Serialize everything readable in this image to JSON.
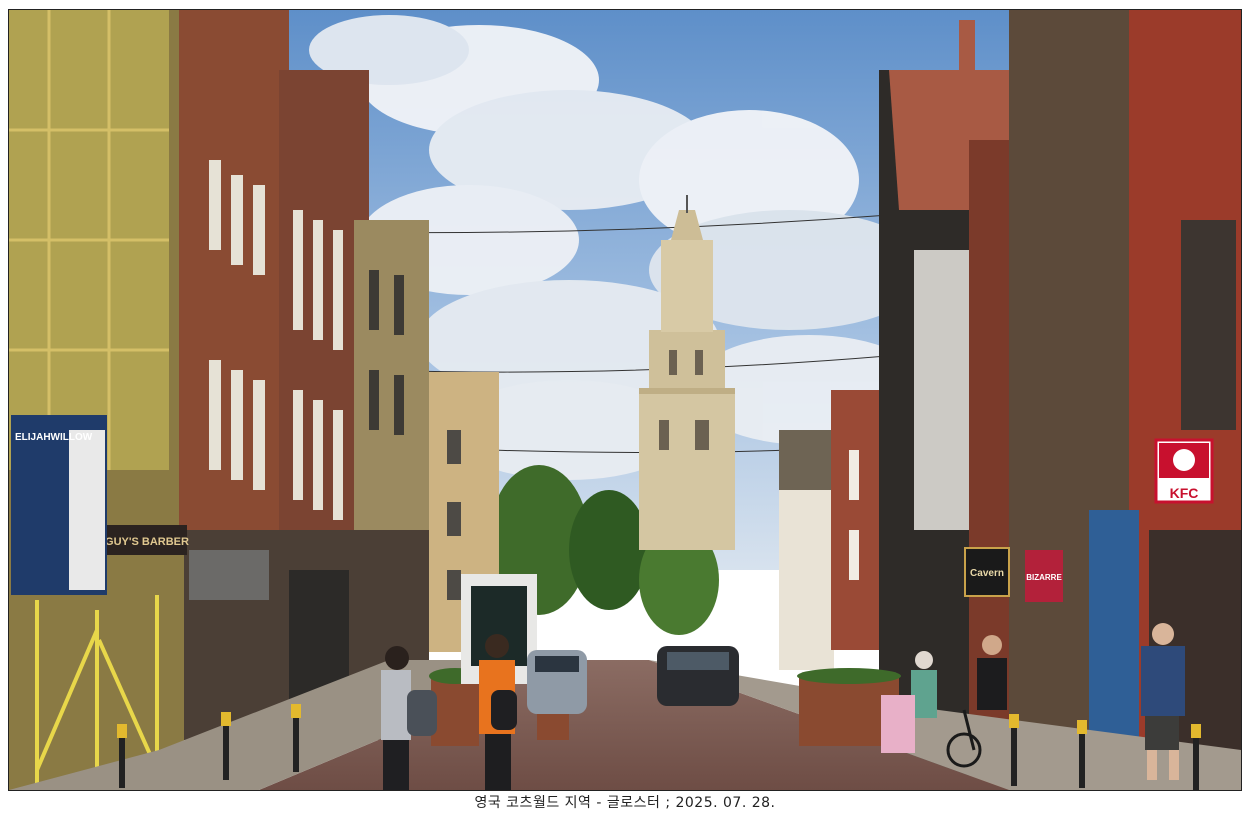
{
  "caption": "영국 코츠월드 지역 - 글로스터 ; 2025. 07. 28.",
  "signs": {
    "kfc": "KFC",
    "guys": "GUY'S BARBER",
    "elijah": "ELIJAHWILLOW",
    "bizarre": "BIZARRE",
    "cavern": "Cavern"
  }
}
